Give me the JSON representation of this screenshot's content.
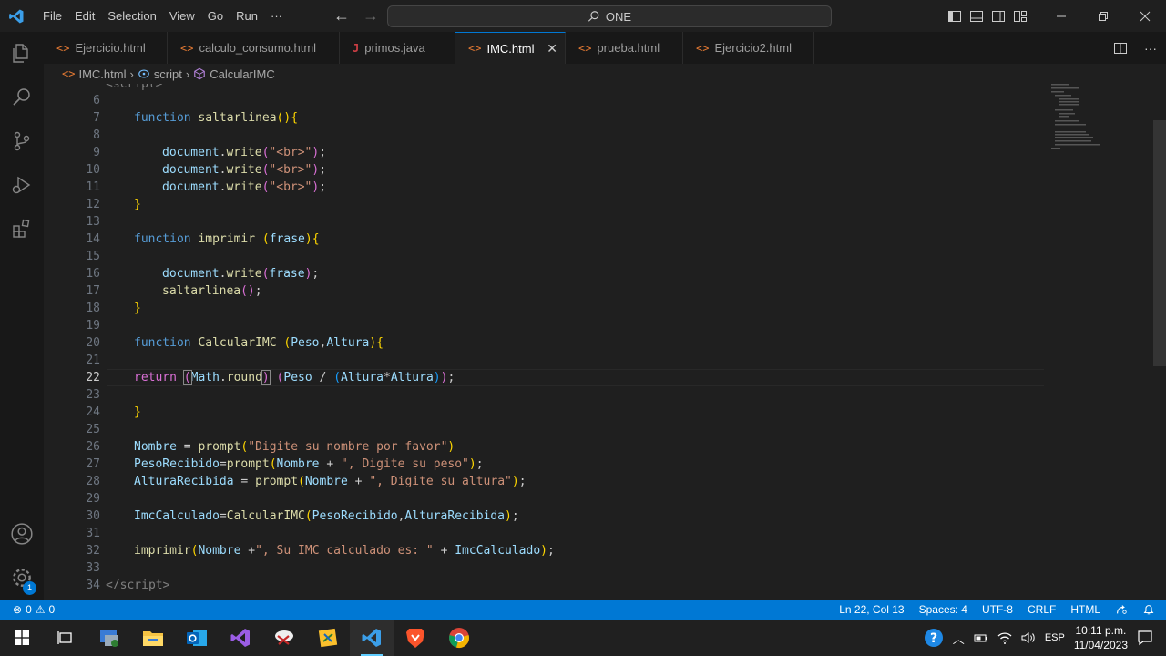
{
  "menu": [
    "File",
    "Edit",
    "Selection",
    "View",
    "Go",
    "Run",
    "···"
  ],
  "command_center": "ONE",
  "tabs": [
    {
      "label": "Ejercicio.html",
      "kind": "html"
    },
    {
      "label": "calculo_consumo.html",
      "kind": "html"
    },
    {
      "label": "primos.java",
      "kind": "java"
    },
    {
      "label": "IMC.html",
      "kind": "html",
      "active": true
    },
    {
      "label": "prueba.html",
      "kind": "html"
    },
    {
      "label": "Ejercicio2.html",
      "kind": "html"
    }
  ],
  "breadcrumb": {
    "file": "IMC.html",
    "part2": "script",
    "part3": "CalcularIMC"
  },
  "editor": {
    "current_line": 22,
    "top_partial": "<script>",
    "lines": [
      6,
      7,
      8,
      9,
      10,
      11,
      12,
      13,
      14,
      15,
      16,
      17,
      18,
      19,
      20,
      21,
      22,
      23,
      24,
      25,
      26,
      27,
      28,
      29,
      30,
      31,
      32,
      33,
      34
    ]
  },
  "status": {
    "errors": "0",
    "warnings": "0",
    "position": "Ln 22, Col 13",
    "spaces": "Spaces: 4",
    "encoding": "UTF-8",
    "eol": "CRLF",
    "language": "HTML"
  },
  "accounts_badge": "1",
  "taskbar": {
    "lang": "ESP",
    "time": "10:11 p.m.",
    "date": "11/04/2023"
  },
  "colors": {
    "accent": "#0078d4",
    "keyword": "#569cd6",
    "function": "#dcdcaa",
    "variable": "#9cdcfe",
    "string": "#ce9178"
  }
}
